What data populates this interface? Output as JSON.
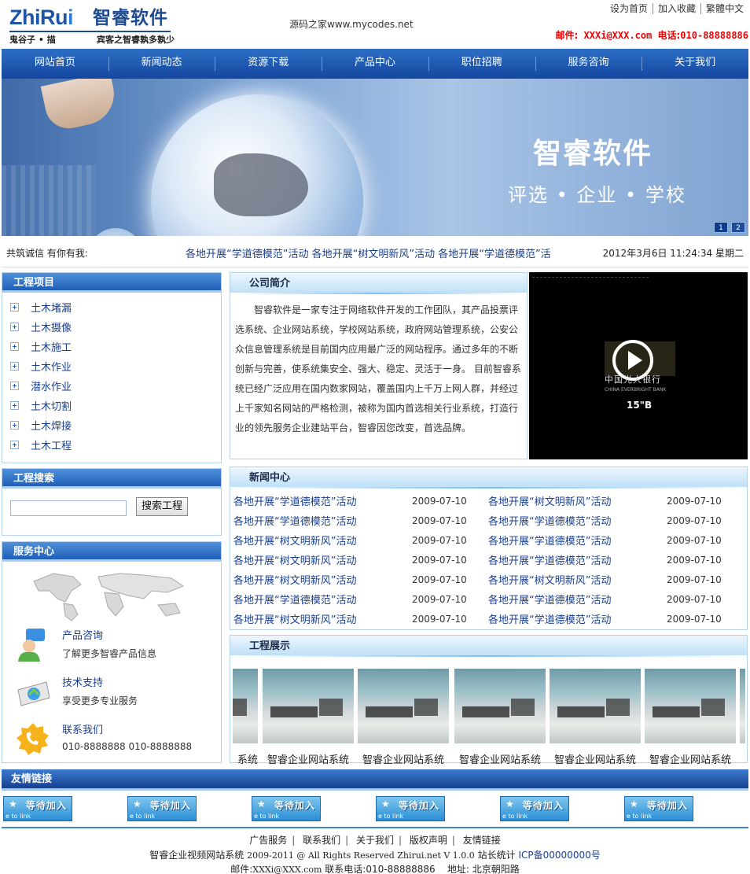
{
  "header": {
    "logo_latin_a": "ZhiRu",
    "logo_latin_b": "i",
    "logo_cn": "智睿软件",
    "logo_sub_left": "鬼谷子 • 描",
    "logo_sub_right": "宾客之智睿孰多孰少",
    "center_text": "源码之家www.mycodes.net",
    "top_links": [
      "设为首页",
      "加入收藏",
      "繁體中文"
    ],
    "contact_email_label": "邮件:",
    "contact_email": "XXXi@XXX.com",
    "contact_phone_label": "电话:",
    "contact_phone": "010-88888886"
  },
  "nav": [
    "网站首页",
    "新闻动态",
    "资源下载",
    "产品中心",
    "职位招聘",
    "服务咨询",
    "关于我们"
  ],
  "banner": {
    "title": "智睿软件",
    "subtitle": "评选 • 企业 • 学校",
    "dots": [
      "1",
      "2"
    ]
  },
  "ticker": {
    "label": "共筑诚信  有你有我:",
    "text": "各地开展“学道德模范”活动  各地开展“树文明新风”活动  各地开展“学道德模范”活",
    "date": "2012年3月6日 11:24:34 星期二"
  },
  "projects": {
    "title": "工程项目",
    "items": [
      "土木堵漏",
      "土木摄像",
      "土木施工",
      "土木作业",
      "潜水作业",
      "土木切割",
      "土木焊接",
      "土木工程"
    ]
  },
  "search": {
    "title": "工程搜索",
    "placeholder": "",
    "button": "搜索工程"
  },
  "service": {
    "title": "服务中心",
    "items": [
      {
        "title": "产品咨询",
        "desc": "了解更多智睿产品信息",
        "icon": "consult-icon"
      },
      {
        "title": "技术支持",
        "desc": "享受更多专业服务",
        "icon": "support-icon"
      },
      {
        "title": "联系我们",
        "desc": "010-8888888 010-8888888",
        "icon": "phone-icon"
      }
    ]
  },
  "about": {
    "title": "公司简介",
    "text": "智睿软件是一家专注于网络软件开发的工作团队，其产品投票评选系统、企业网站系统，学校网站系统，政府网站管理系统，公安公众信息管理系统是目前国内应用最广泛的网站程序。通过多年的不断创新与完善，使系统集安全、强大、稳定、灵活于一身。 目前智睿系统已经广泛应用在国内数家网站，覆盖国内上千万上网人群，并经过上千家知名网站的严格检测，被称为国内首选相关行业系统，打造行业的领先服务企业建站平台，智睿因您改变，首选品牌。"
  },
  "video": {
    "brand_cn": "中国光大银行",
    "brand_en": "CHINA EVERBRIGHT BANK",
    "caption": "15\"B"
  },
  "news": {
    "title": "新闻中心",
    "rows": [
      {
        "t1": "各地开展“学道德模范”活动",
        "d1": "2009-07-10",
        "t2": "各地开展“树文明新风”活动",
        "d2": "2009-07-10"
      },
      {
        "t1": "各地开展“学道德模范”活动",
        "d1": "2009-07-10",
        "t2": "各地开展“学道德模范”活动",
        "d2": "2009-07-10"
      },
      {
        "t1": "各地开展“树文明新风”活动",
        "d1": "2009-07-10",
        "t2": "各地开展“学道德模范”活动",
        "d2": "2009-07-10"
      },
      {
        "t1": "各地开展“树文明新风”活动",
        "d1": "2009-07-10",
        "t2": "各地开展“学道德模范”活动",
        "d2": "2009-07-10"
      },
      {
        "t1": "各地开展“树文明新风”活动",
        "d1": "2009-07-10",
        "t2": "各地开展“树文明新风”活动",
        "d2": "2009-07-10"
      },
      {
        "t1": "各地开展“学道德模范”活动",
        "d1": "2009-07-10",
        "t2": "各地开展“学道德模范”活动",
        "d2": "2009-07-10"
      },
      {
        "t1": "各地开展“树文明新风”活动",
        "d1": "2009-07-10",
        "t2": "各地开展“学道德模范”活动",
        "d2": "2009-07-10"
      }
    ]
  },
  "showcase": {
    "title": "工程展示",
    "partial_caption": "系统",
    "captions": [
      "智睿企业网站系统",
      "智睿企业网站系统",
      "智睿企业网站系统",
      "智睿企业网站系统",
      "智睿企业网站系统"
    ]
  },
  "friends": {
    "title": "友情链接",
    "logo_text": "等待加入",
    "logo_sub": "e to link",
    "count": 6
  },
  "footer": {
    "links": [
      "广告服务",
      "联系我们",
      "关于我们",
      "版权声明",
      "友情链接"
    ],
    "copy_cn": "智睿企业视频网站系统",
    "copy_en": "2009-2011 @ All Rights Reserved Zhirui.net V 1.0.0",
    "stat": "站长统计",
    "icp": "ICP备00000000号",
    "email_label": "邮件:",
    "email": "XXXi@XXX.com",
    "phone_label": "联系电话:",
    "phone": "010-88888886",
    "addr_label": "地址:",
    "addr": "北京朝阳路"
  },
  "colors": {
    "nav_blue": "#1f5fb8",
    "link_blue": "#1a3f8f",
    "contact_red": "#ee0000"
  }
}
